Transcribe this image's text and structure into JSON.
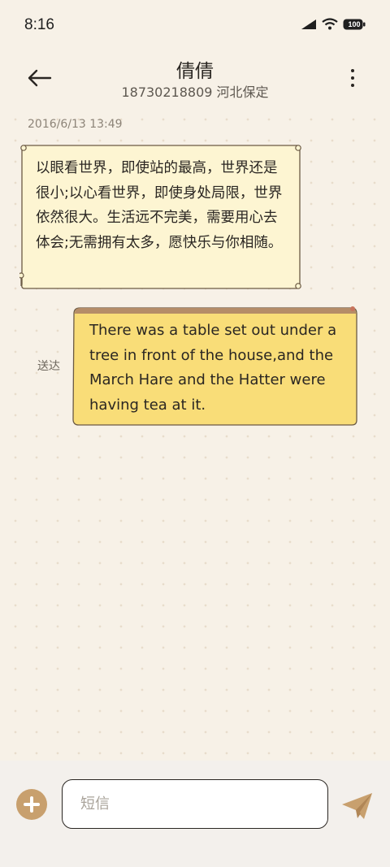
{
  "status_bar": {
    "time": "8:16",
    "battery": "100",
    "icons": [
      "signal-icon",
      "wifi-icon",
      "battery-icon"
    ]
  },
  "header": {
    "contact_name": "倩倩",
    "contact_detail": "18730218809 河北保定"
  },
  "messages": {
    "timestamp": "2016/6/13 13:49",
    "incoming_text": "以眼看世界，即使站的最高，世界还是很小;以心看世界，即使身处局限，世界依然很大。生活远不完美，需要用心去体会;无需拥有太多，愿快乐与你相随。",
    "outgoing_status": "送达",
    "outgoing_text": "There was a table set out under a tree in front of the house,and the March Hare and the Hatter were having tea at it."
  },
  "composer": {
    "placeholder": "短信",
    "value": ""
  },
  "colors": {
    "background": "#f7f1e7",
    "incoming_bubble": "#fdf5d2",
    "outgoing_bubble": "#f9dd78",
    "accent": "#c8a06e"
  }
}
